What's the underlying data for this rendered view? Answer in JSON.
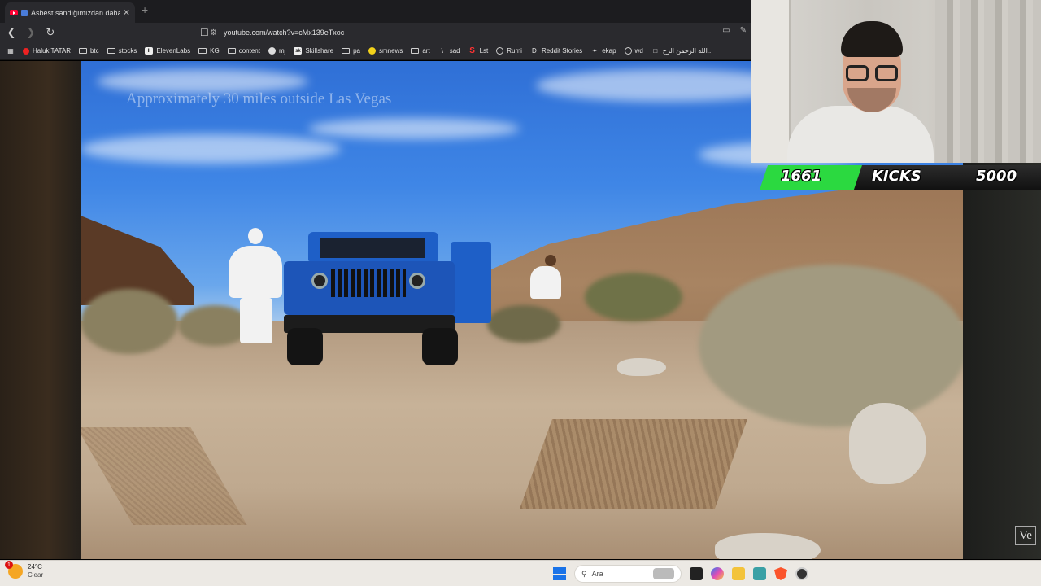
{
  "browser": {
    "tab_title": "Asbest sandığımızdan daha b",
    "tab_close": "✕",
    "new_tab": "+",
    "url": "youtube.com/watch?v=cMx139eTxoc",
    "bookmarks": [
      {
        "label": "Haluk TATAR",
        "icon": "youtube-icon"
      },
      {
        "label": "btc",
        "icon": "folder-icon"
      },
      {
        "label": "stocks",
        "icon": "folder-icon"
      },
      {
        "label": "ElevenLabs",
        "icon": "elevenlabs-icon"
      },
      {
        "label": "KG",
        "icon": "folder-icon"
      },
      {
        "label": "content",
        "icon": "folder-icon"
      },
      {
        "label": "mj",
        "icon": "github-icon"
      },
      {
        "label": "Skillshare",
        "icon": "skillshare-icon"
      },
      {
        "label": "pa",
        "icon": "folder-icon"
      },
      {
        "label": "smnews",
        "icon": "smiley-icon"
      },
      {
        "label": "art",
        "icon": "folder-icon"
      },
      {
        "label": "sad",
        "icon": "slash-icon"
      },
      {
        "label": "Lst",
        "icon": "s-icon"
      },
      {
        "label": "Rumi",
        "icon": "globe-icon"
      },
      {
        "label": "Reddit Stories",
        "icon": "d-icon"
      },
      {
        "label": "ekap",
        "icon": "bird-icon"
      },
      {
        "label": "wd",
        "icon": "globe-icon"
      },
      {
        "label": "الله الرحمن الرح...",
        "icon": "doc-icon"
      }
    ]
  },
  "video": {
    "caption": "Approximately 30 miles outside Las Vegas"
  },
  "stream_overlay": {
    "current": "1661",
    "label": "KICKS",
    "goal": "5000",
    "progress_fraction": 0.3322,
    "accent_color": "#2bd940",
    "watermark": "Ve"
  },
  "taskbar": {
    "temperature": "24°C",
    "condition": "Clear",
    "alert_count": "1",
    "search_placeholder": "Ara"
  }
}
